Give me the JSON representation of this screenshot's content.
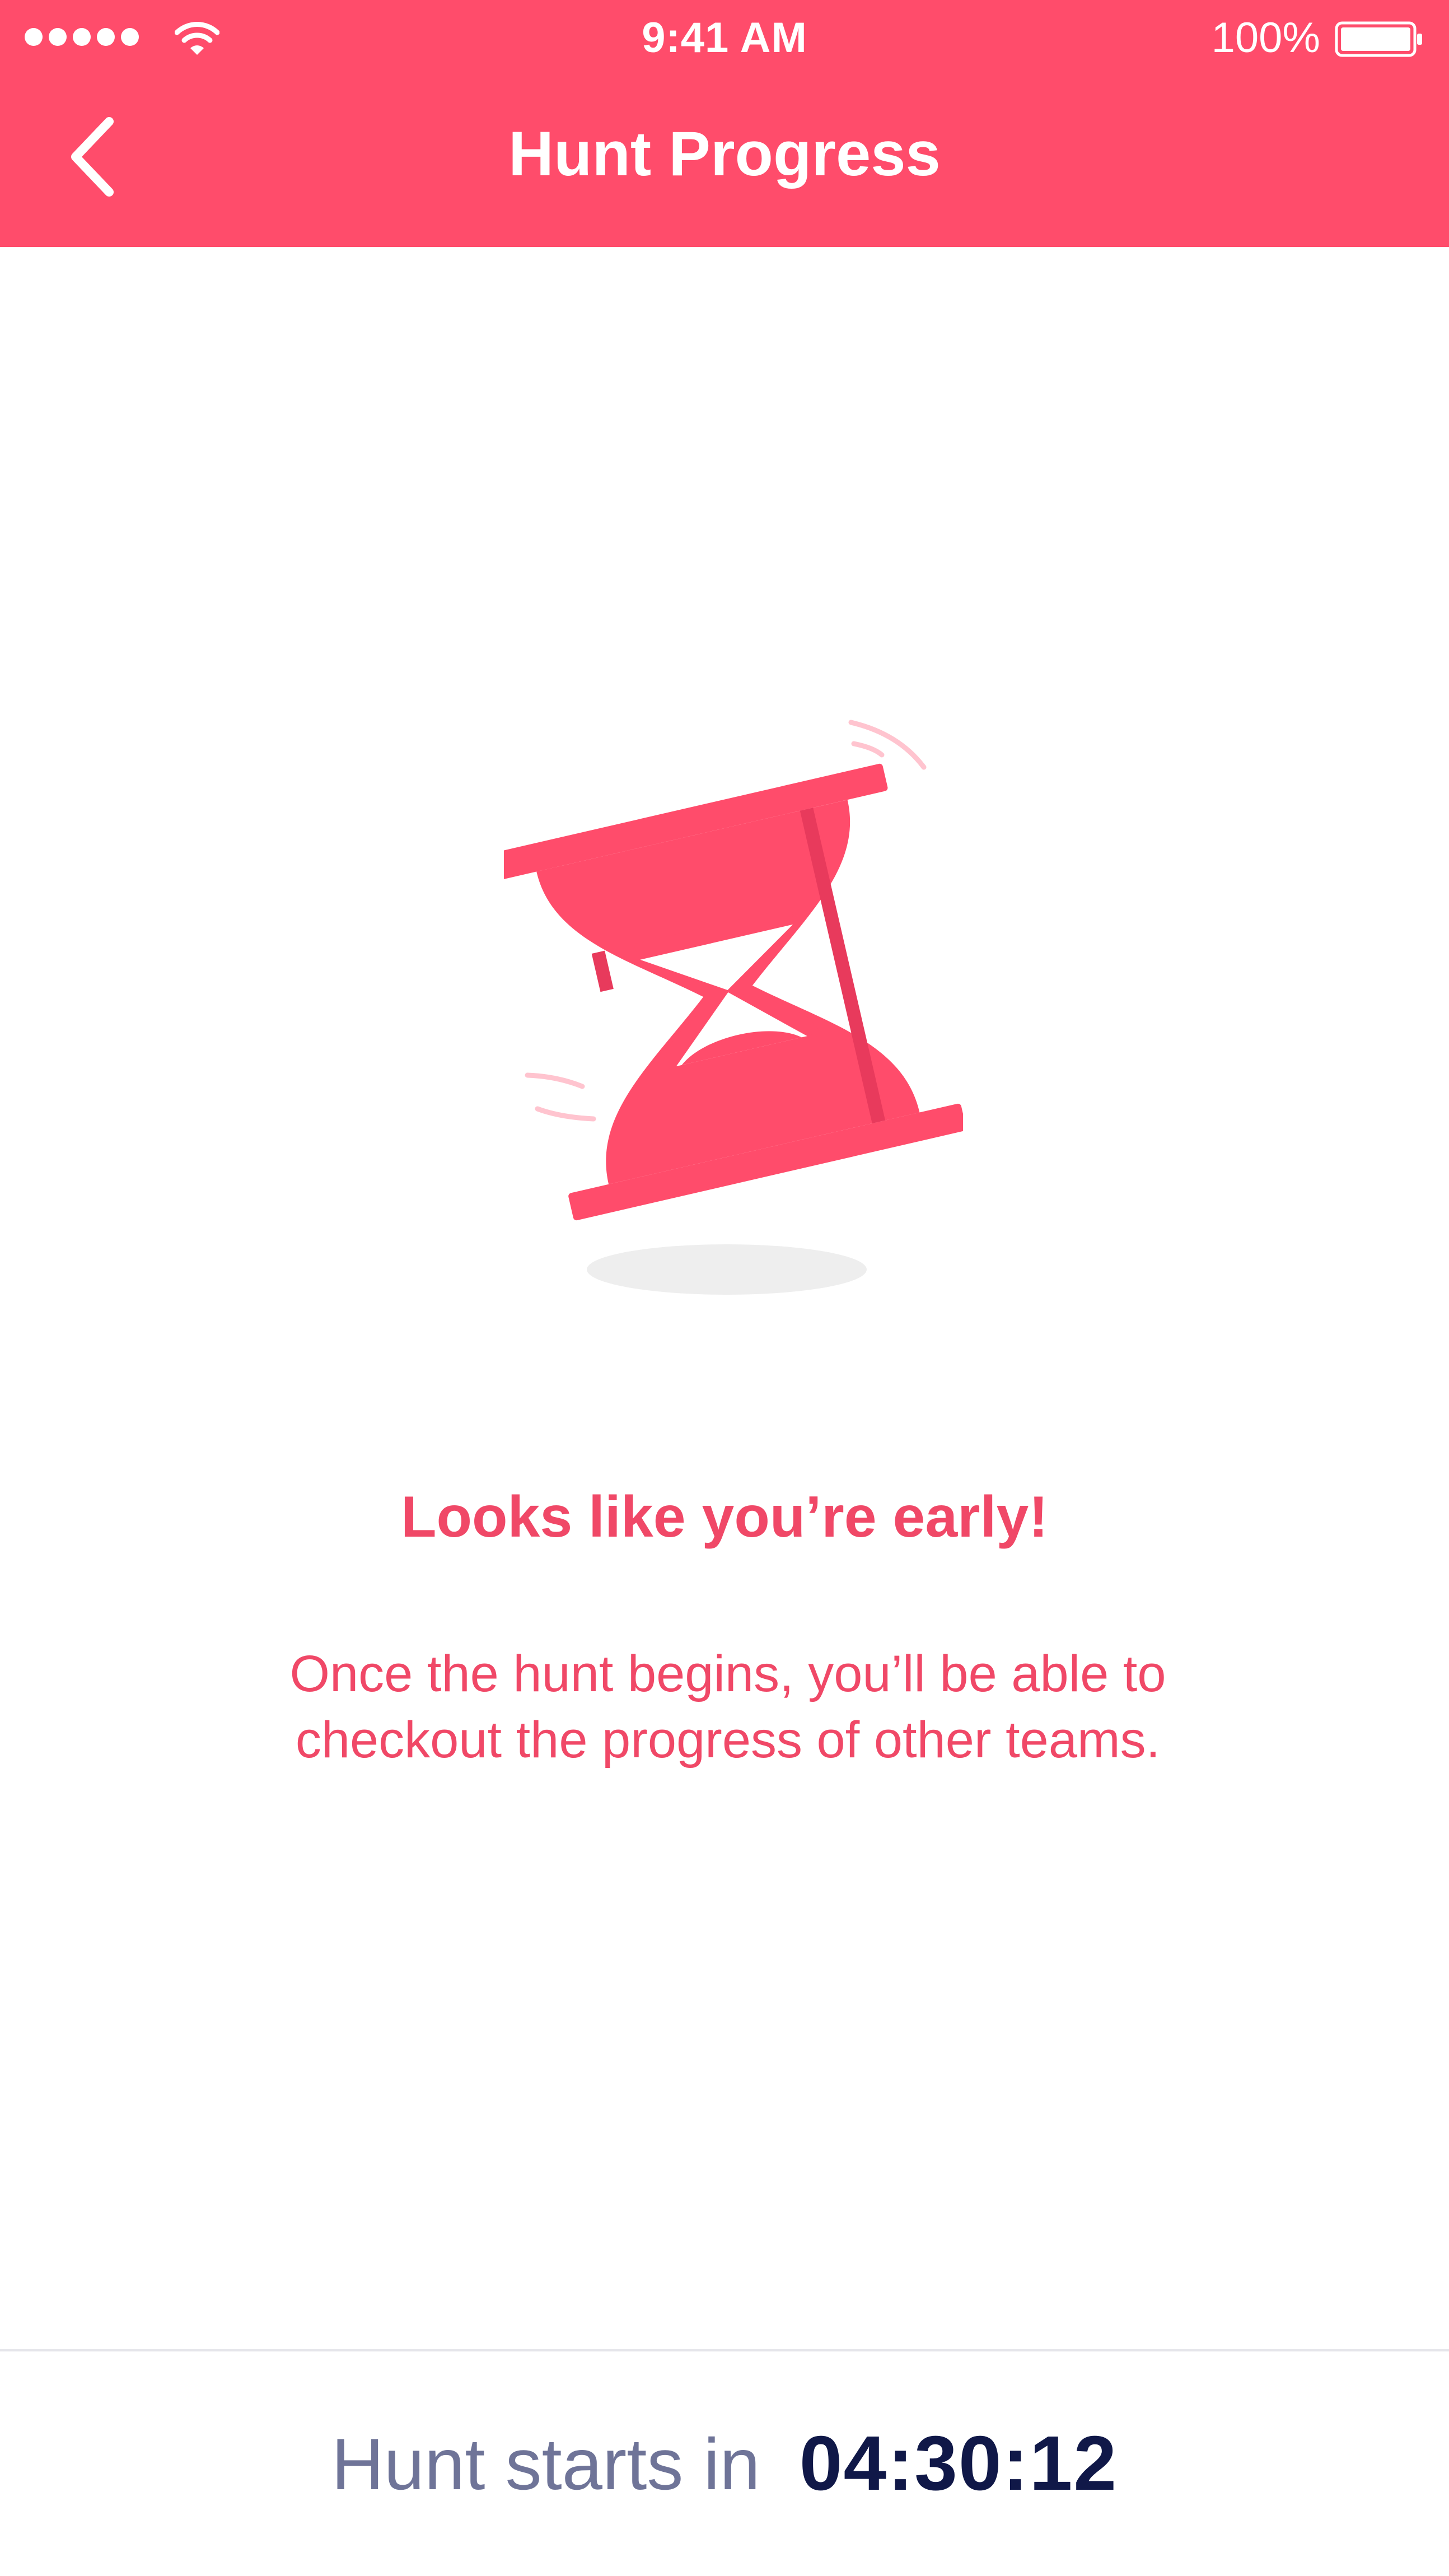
{
  "status_bar": {
    "time": "9:41 AM",
    "battery_percent": "100%",
    "signal_icon": "signal-dots-icon",
    "wifi_icon": "wifi-icon",
    "battery_icon": "battery-icon"
  },
  "header": {
    "title": "Hunt Progress",
    "back_icon": "chevron-left-icon"
  },
  "illustration": {
    "icon": "hourglass-icon"
  },
  "message": {
    "headline": "Looks like you’re early!",
    "body": "Once the hunt begins, you’ll be able to checkout the progress of other teams."
  },
  "footer": {
    "label": "Hunt starts in",
    "countdown": "04:30:12"
  },
  "colors": {
    "brand": "#ff4c6b",
    "text_accent": "#f04867",
    "footer_label": "#6f7498",
    "footer_timer": "#101848",
    "divider": "#e5e5ea"
  }
}
